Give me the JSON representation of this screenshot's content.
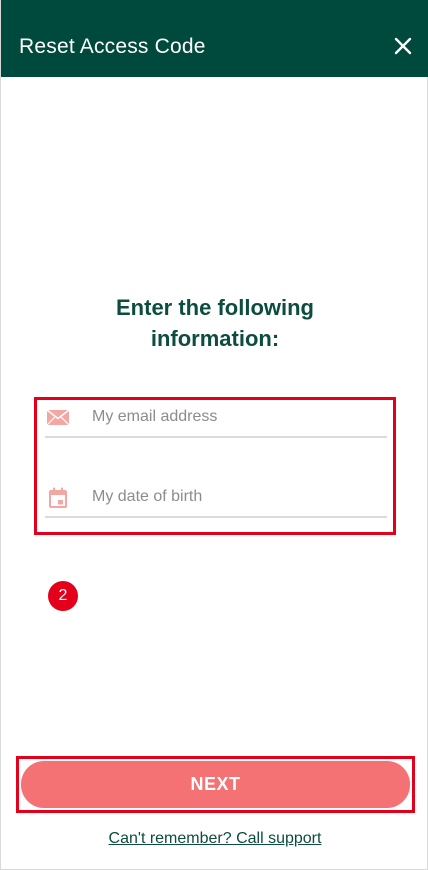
{
  "header": {
    "title": "Reset Access Code",
    "close_icon": "close-icon",
    "background": "#004a3d"
  },
  "main": {
    "heading_line1": "Enter the following",
    "heading_line2": "information:",
    "email": {
      "icon": "envelope-icon",
      "placeholder": "My email address",
      "value": ""
    },
    "dob": {
      "icon": "calendar-icon",
      "placeholder": "My date of birth",
      "value": ""
    },
    "step_badge": "2"
  },
  "footer": {
    "next_label": "NEXT",
    "support_link": "Can't remember? Call support"
  },
  "colors": {
    "brand": "#004a3d",
    "heading": "#0d4d3f",
    "button": "#f47273",
    "icon": "#f2a7a3",
    "highlight": "#e4001b"
  }
}
